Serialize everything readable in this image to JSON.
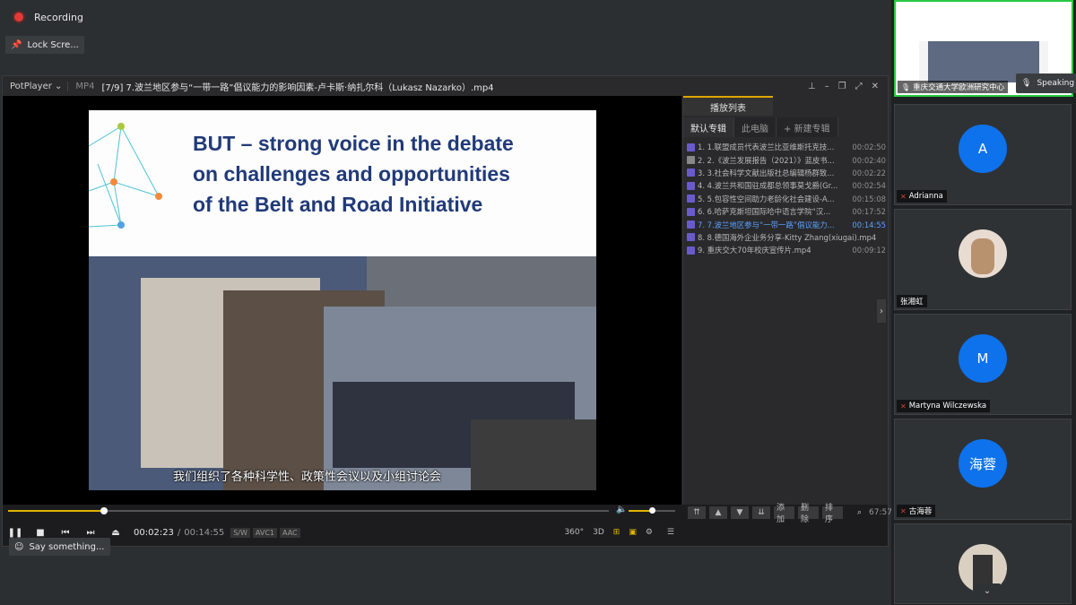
{
  "meeting": {
    "recording_label": "Recording",
    "lock_screen_label": "Lock Scre...",
    "chat_placeholder": "Say something...",
    "speaking_label": "Speaking"
  },
  "player": {
    "app_name": "PotPlayer",
    "format": "MP4",
    "file_title": "[7/9] 7.波兰地区参与“一带一路”倡议能力的影响因素-卢卡斯·纳扎尔科（Lukasz Nazarko）.mp4",
    "slide": {
      "title_line1": "BUT – strong voice in the debate",
      "title_line2": "on challenges and opportunities",
      "title_line3": "of the Belt and Road Initiative",
      "subtitle": "我们组织了各种科学性、政策性会议以及小组讨论会"
    },
    "time_current": "00:02:23",
    "time_separator": "/",
    "time_total": "00:14:55",
    "tags": [
      "S/W",
      "AVC1",
      "AAC"
    ],
    "right_controls": [
      "360°",
      "3D"
    ],
    "seek_fraction": 0.16,
    "volume_fraction": 0.5
  },
  "playlist": {
    "header": "播放列表",
    "tabs": [
      "默认专辑",
      "此电脑",
      "+ 新建专辑"
    ],
    "items": [
      {
        "title": "1. 1.联盟成员代表波兰比亚维斯托克技...",
        "duration": "00:02:50",
        "current": false
      },
      {
        "title": "2. 2.《波兰发展报告（2021）》蓝皮书...",
        "duration": "00:02:40",
        "current": false
      },
      {
        "title": "3. 3.社会科学文献出版社总编辑杨群致...",
        "duration": "00:02:22",
        "current": false
      },
      {
        "title": "4. 4.波兰共和国驻成都总领事莫戈爵(Gr...",
        "duration": "00:02:54",
        "current": false
      },
      {
        "title": "5. 5.包容性空间助力老龄化社会建设-A...",
        "duration": "00:15:08",
        "current": false
      },
      {
        "title": "6. 6.哈萨克斯坦国际哈中语言学院“汉...",
        "duration": "00:17:52",
        "current": false
      },
      {
        "title": "7. 7.波兰地区参与“一带一路”倡议能力...",
        "duration": "00:14:55",
        "current": true
      },
      {
        "title": "8. 8.德国海外企业务分享-Kitty Zhang(xiugai).mp4",
        "duration": "",
        "current": false
      },
      {
        "title": "9. 重庆交大70年校庆宣传片.mp4",
        "duration": "00:09:12",
        "current": false
      }
    ],
    "footer_buttons": [
      "添加",
      "删除",
      "排序"
    ],
    "total_time": "67:57"
  },
  "participants": [
    {
      "name": "重庆交通大学欧洲研究中心",
      "type": "video",
      "active": true
    },
    {
      "name": "Adrianna",
      "type": "initial",
      "initial": "A"
    },
    {
      "name": "张湘虹",
      "type": "photo"
    },
    {
      "name": "Martyna Wilczewska",
      "type": "initial",
      "initial": "M"
    },
    {
      "name": "古海蓉",
      "type": "initial",
      "initial": "海蓉"
    },
    {
      "name": "",
      "type": "photo2"
    }
  ],
  "colors": {
    "accent": "#e0b400",
    "avatar_blue": "#0e72ed",
    "active_border": "#27c93f",
    "slide_title": "#213a78",
    "current_item": "#5aa0ff"
  }
}
